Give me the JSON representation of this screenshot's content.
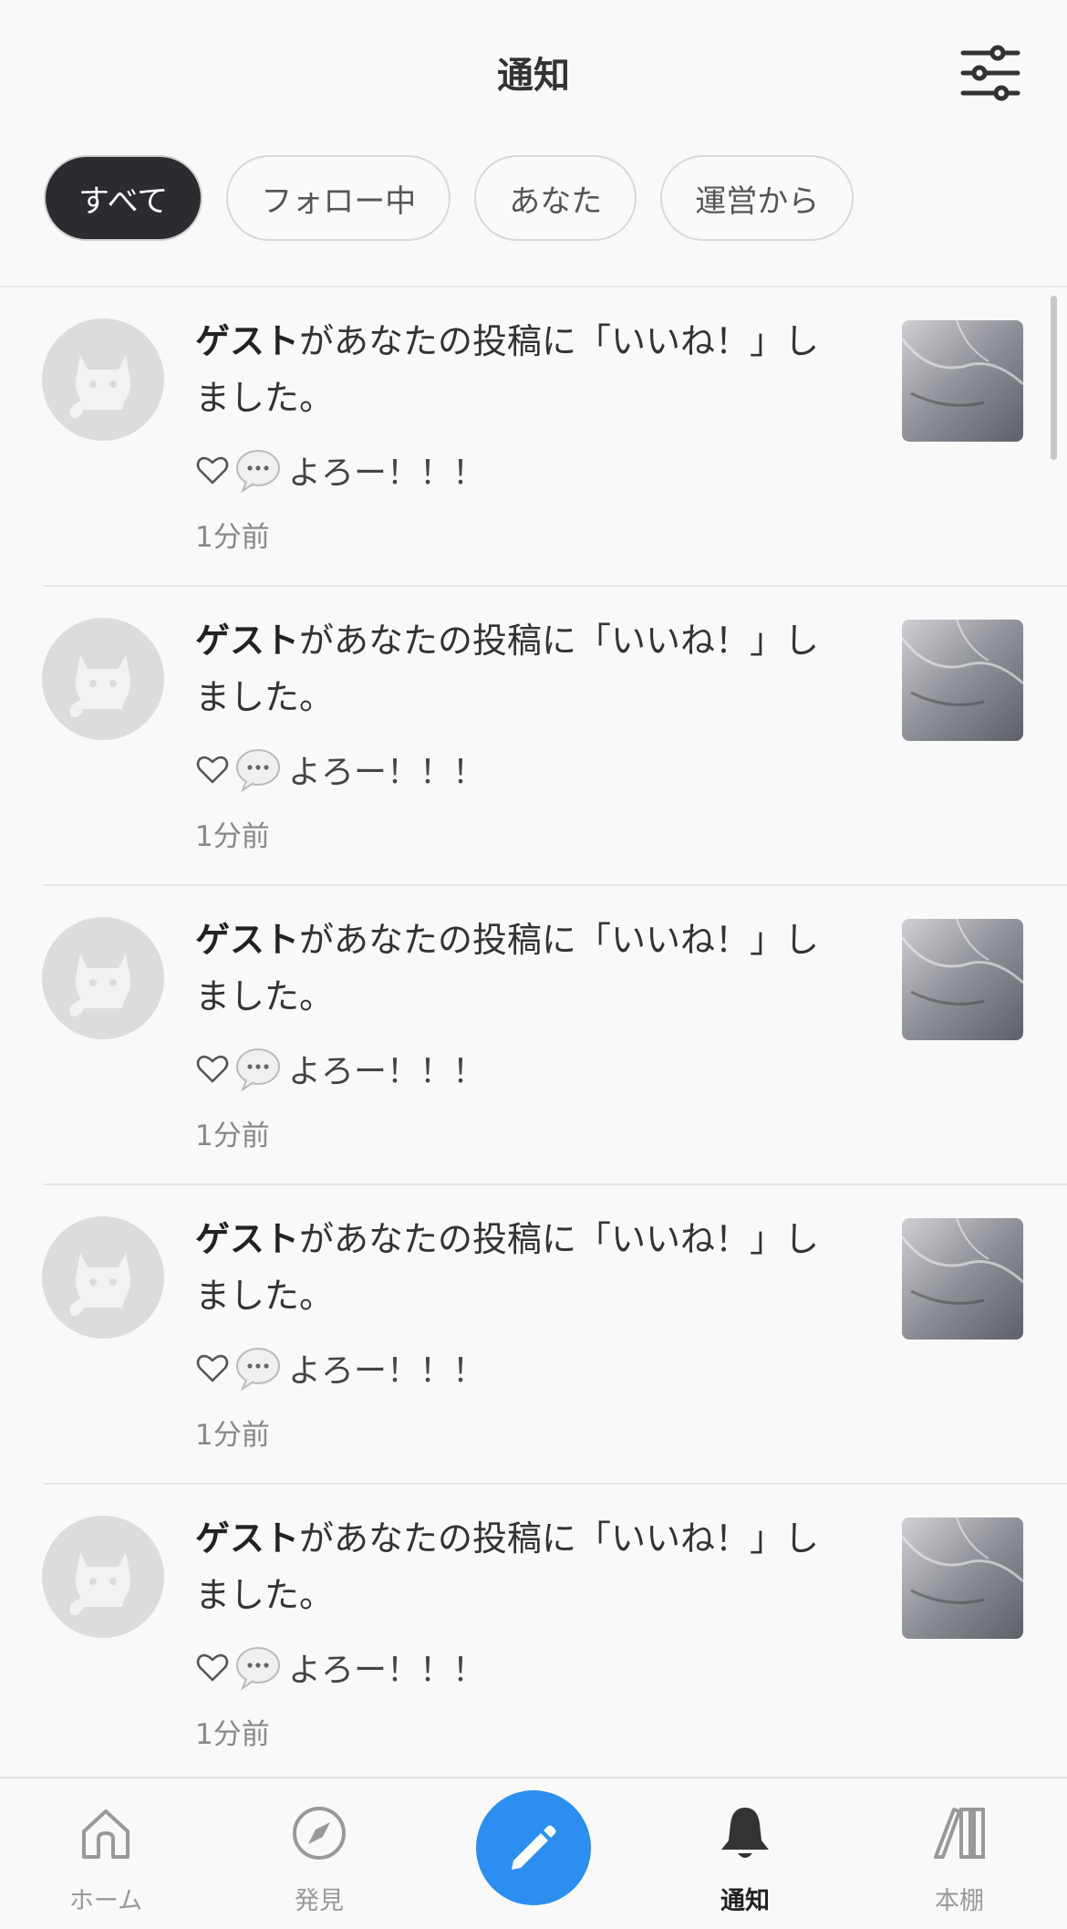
{
  "header": {
    "title": "通知"
  },
  "tabs": [
    {
      "label": "すべて",
      "active": true
    },
    {
      "label": "フォロー中",
      "active": false
    },
    {
      "label": "あなた",
      "active": false
    },
    {
      "label": "運営から",
      "active": false
    }
  ],
  "notifications": [
    {
      "user": "ゲスト",
      "message": "があなたの投稿に「いいね！」しました。",
      "reaction_text": "よろー！！！",
      "time": "1分前"
    },
    {
      "user": "ゲスト",
      "message": "があなたの投稿に「いいね！」しました。",
      "reaction_text": "よろー！！！",
      "time": "1分前"
    },
    {
      "user": "ゲスト",
      "message": "があなたの投稿に「いいね！」しました。",
      "reaction_text": "よろー！！！",
      "time": "1分前"
    },
    {
      "user": "ゲスト",
      "message": "があなたの投稿に「いいね！」しました。",
      "reaction_text": "よろー！！！",
      "time": "1分前"
    },
    {
      "user": "ゲスト",
      "message": "があなたの投稿に「いいね！」しました。",
      "reaction_text": "よろー！！！",
      "time": "1分前"
    }
  ],
  "bottom_nav": [
    {
      "label": "ホーム",
      "icon": "home-icon",
      "active": false
    },
    {
      "label": "発見",
      "icon": "compass-icon",
      "active": false
    },
    {
      "label": "通知",
      "icon": "bell-icon",
      "active": true
    },
    {
      "label": "本棚",
      "icon": "bookshelf-icon",
      "active": false
    }
  ],
  "colors": {
    "accent": "#2b8ef0",
    "active_tab": "#2a2c30"
  }
}
